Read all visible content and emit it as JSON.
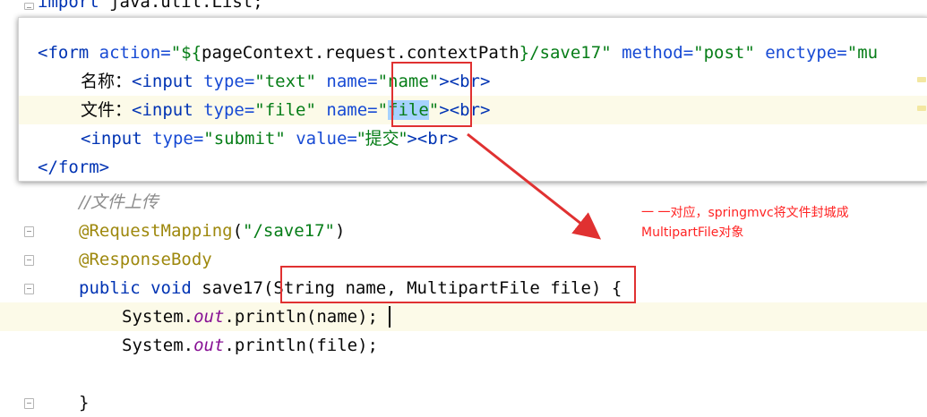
{
  "editor": {
    "top_partial": {
      "kw": "import",
      "rest": " java.util.List;"
    },
    "comment": "//文件上传",
    "ann1_name": "@RequestMapping",
    "ann1_open": "(",
    "ann1_value": "\"/save17\"",
    "ann1_close": ")",
    "ann2": "@ResponseBody",
    "sig_kw1": "public",
    "sig_kw2": "void",
    "sig_name": " save17",
    "sig_params": "(String name, MultipartFile file)",
    "sig_open": " {",
    "print1": {
      "obj": "System.",
      "field": "out",
      "call": ".println(name);"
    },
    "print2": {
      "obj": "System.",
      "field": "out",
      "call": ".println(file);"
    },
    "close_brace": "}"
  },
  "popup": {
    "form_line": {
      "open": "<form ",
      "a1": "action=",
      "v1a": "\"${",
      "v1b": "pageContext.request.contextPath",
      "v1c": "}",
      "v1d": "/save17",
      "v1e": "\" ",
      "a2": "method=",
      "v2": "\"post\" ",
      "a3": "enctype=",
      "v3": "\"mu"
    },
    "line2": {
      "label": "名称：",
      "t1": "<input ",
      "a1": "type=",
      "v1": "\"text\" ",
      "a2": "name=",
      "v2": "\"name\"",
      "t2": "><br>"
    },
    "line3": {
      "label": "文件：",
      "t1": "<input ",
      "a1": "type=",
      "v1": "\"file\" ",
      "a2": "name=",
      "v2a": "\"",
      "v2b": "file",
      "v2c": "\"",
      "t2": "><br>"
    },
    "line4": {
      "t1": "<input ",
      "a1": "type=",
      "v1": "\"submit\" ",
      "a2": "value=",
      "v2": "\"提交\"",
      "t2": "><br>"
    },
    "line5": "</form>"
  },
  "annotation": {
    "line1": "一 一对应，springmvc将文件封城成",
    "line2": "MultipartFile对象"
  },
  "colors": {
    "highlight": "#e03131",
    "annotation_text": "#ff2424"
  }
}
